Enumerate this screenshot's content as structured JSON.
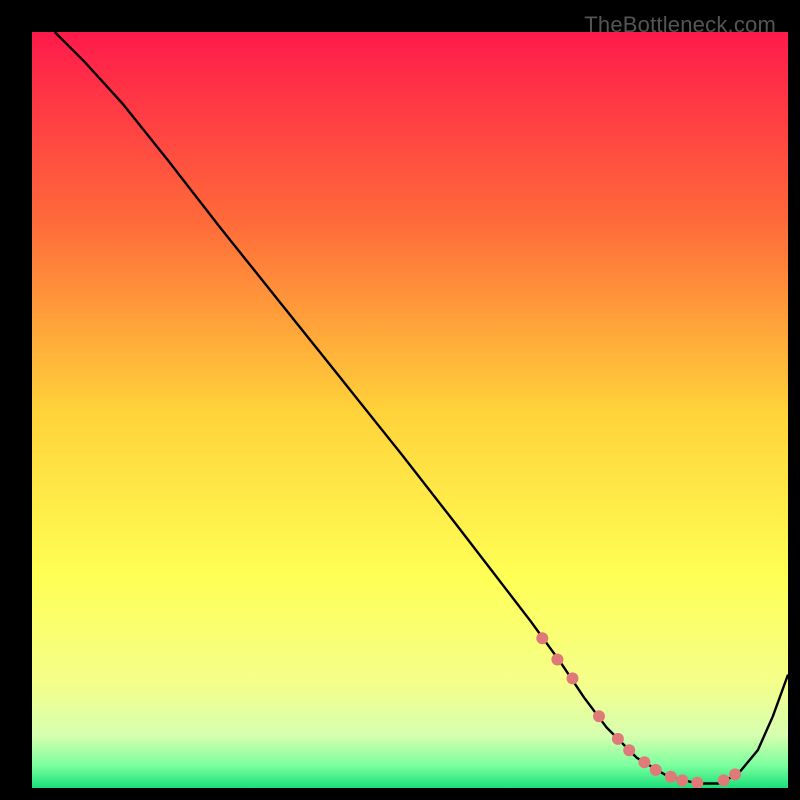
{
  "watermark": "TheBottleneck.com",
  "chart_data": {
    "type": "line",
    "title": "",
    "xlabel": "",
    "ylabel": "",
    "xlim": [
      0,
      100
    ],
    "ylim": [
      0,
      100
    ],
    "gradient_stops": [
      {
        "pos": 0.0,
        "color": "#ff1a4b"
      },
      {
        "pos": 0.25,
        "color": "#ff6a3a"
      },
      {
        "pos": 0.5,
        "color": "#ffd23a"
      },
      {
        "pos": 0.72,
        "color": "#ffff55"
      },
      {
        "pos": 0.86,
        "color": "#f5ff8a"
      },
      {
        "pos": 0.93,
        "color": "#d7ffb0"
      },
      {
        "pos": 0.97,
        "color": "#7cff9e"
      },
      {
        "pos": 1.0,
        "color": "#19e07a"
      }
    ],
    "series": [
      {
        "name": "curve",
        "x": [
          3,
          7,
          12,
          18,
          25,
          33,
          41,
          49,
          56,
          61,
          66,
          70,
          73,
          76,
          80,
          84,
          88,
          91,
          93.5,
          96,
          98,
          100
        ],
        "y": [
          100,
          96,
          90.5,
          83,
          74,
          64,
          54,
          44,
          35,
          28.5,
          22,
          16.5,
          12,
          8,
          4,
          1.6,
          0.6,
          0.6,
          2.0,
          5.0,
          9.5,
          15
        ]
      }
    ],
    "markers": {
      "name": "dots",
      "x": [
        67.5,
        69.5,
        71.5,
        75.0,
        77.5,
        79.0,
        81.0,
        82.5,
        84.5,
        86.0,
        88.0,
        91.5,
        93.0
      ],
      "y": [
        19.8,
        17.0,
        14.5,
        9.5,
        6.5,
        5.0,
        3.4,
        2.4,
        1.5,
        1.0,
        0.7,
        1.0,
        1.8
      ],
      "color": "#e07a78",
      "radius": 6
    }
  }
}
